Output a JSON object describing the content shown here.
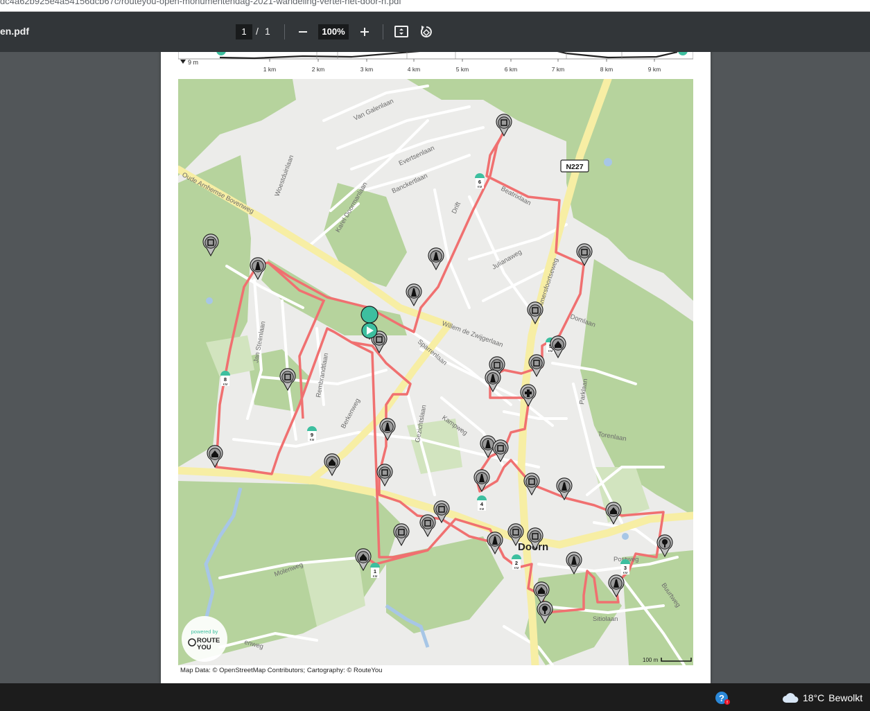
{
  "browser": {
    "url": "dc4a62b925e4a54156dcb67c/routeyou-open-monumentendag-2021-wandeling-vertel-het-door-n.pdf"
  },
  "toolbar": {
    "doc_title": "en.pdf",
    "current_page": "1",
    "page_separator": "/",
    "total_pages": "1",
    "zoom_out_label": "—",
    "zoom_level": "100%",
    "zoom_in_label": "+",
    "fit_icon": "fit-page-icon",
    "rotate_icon": "rotate-icon"
  },
  "elevation": {
    "min_label": "9 m",
    "km_labels": [
      "1 km",
      "2 km",
      "3 km",
      "4 km",
      "5 km",
      "6 km",
      "7 km",
      "8 km",
      "9 km"
    ]
  },
  "map": {
    "road_badge": "N227",
    "street_labels": [
      "Van Galenlaan",
      "Evertsenlaan",
      "Banckertlaan",
      "Karel Doormanlaan",
      "Oude Arnhemse Bovenweg",
      "Woestduinlaan",
      "Jan Steenlaan",
      "Rembrandtlaan",
      "Berkenweg",
      "Drift",
      "Beatrixlaan",
      "Julianaweg",
      "Amersfoortseweg",
      "Willem de Zwijgerlaan",
      "Domlaan",
      "Sparrenlaan",
      "Gezichtslaan",
      "Kampweg",
      "Parklaan",
      "Torenlaan",
      "Molenweg",
      "Postweg",
      "Sitiolaan",
      "Buurtweg",
      "enweg"
    ],
    "town_label": "Doorn",
    "km_markers": [
      "1",
      "2",
      "3",
      "4",
      "5",
      "6",
      "8",
      "9"
    ],
    "km_unit": "KM",
    "scale_label": "100 m",
    "logo_powered": "powered by",
    "logo_name_1": "ROUTE",
    "logo_name_2": "YOU",
    "route_color": "#f07070",
    "accent_color": "#3dbf9f"
  },
  "attribution": "Map Data: © OpenStreetMap Contributors; Cartography: ©  RouteYou",
  "taskbar": {
    "temperature": "18°C",
    "condition": "Bewolkt",
    "weather_icon": "cloud-icon",
    "help_icon": "help-icon"
  }
}
